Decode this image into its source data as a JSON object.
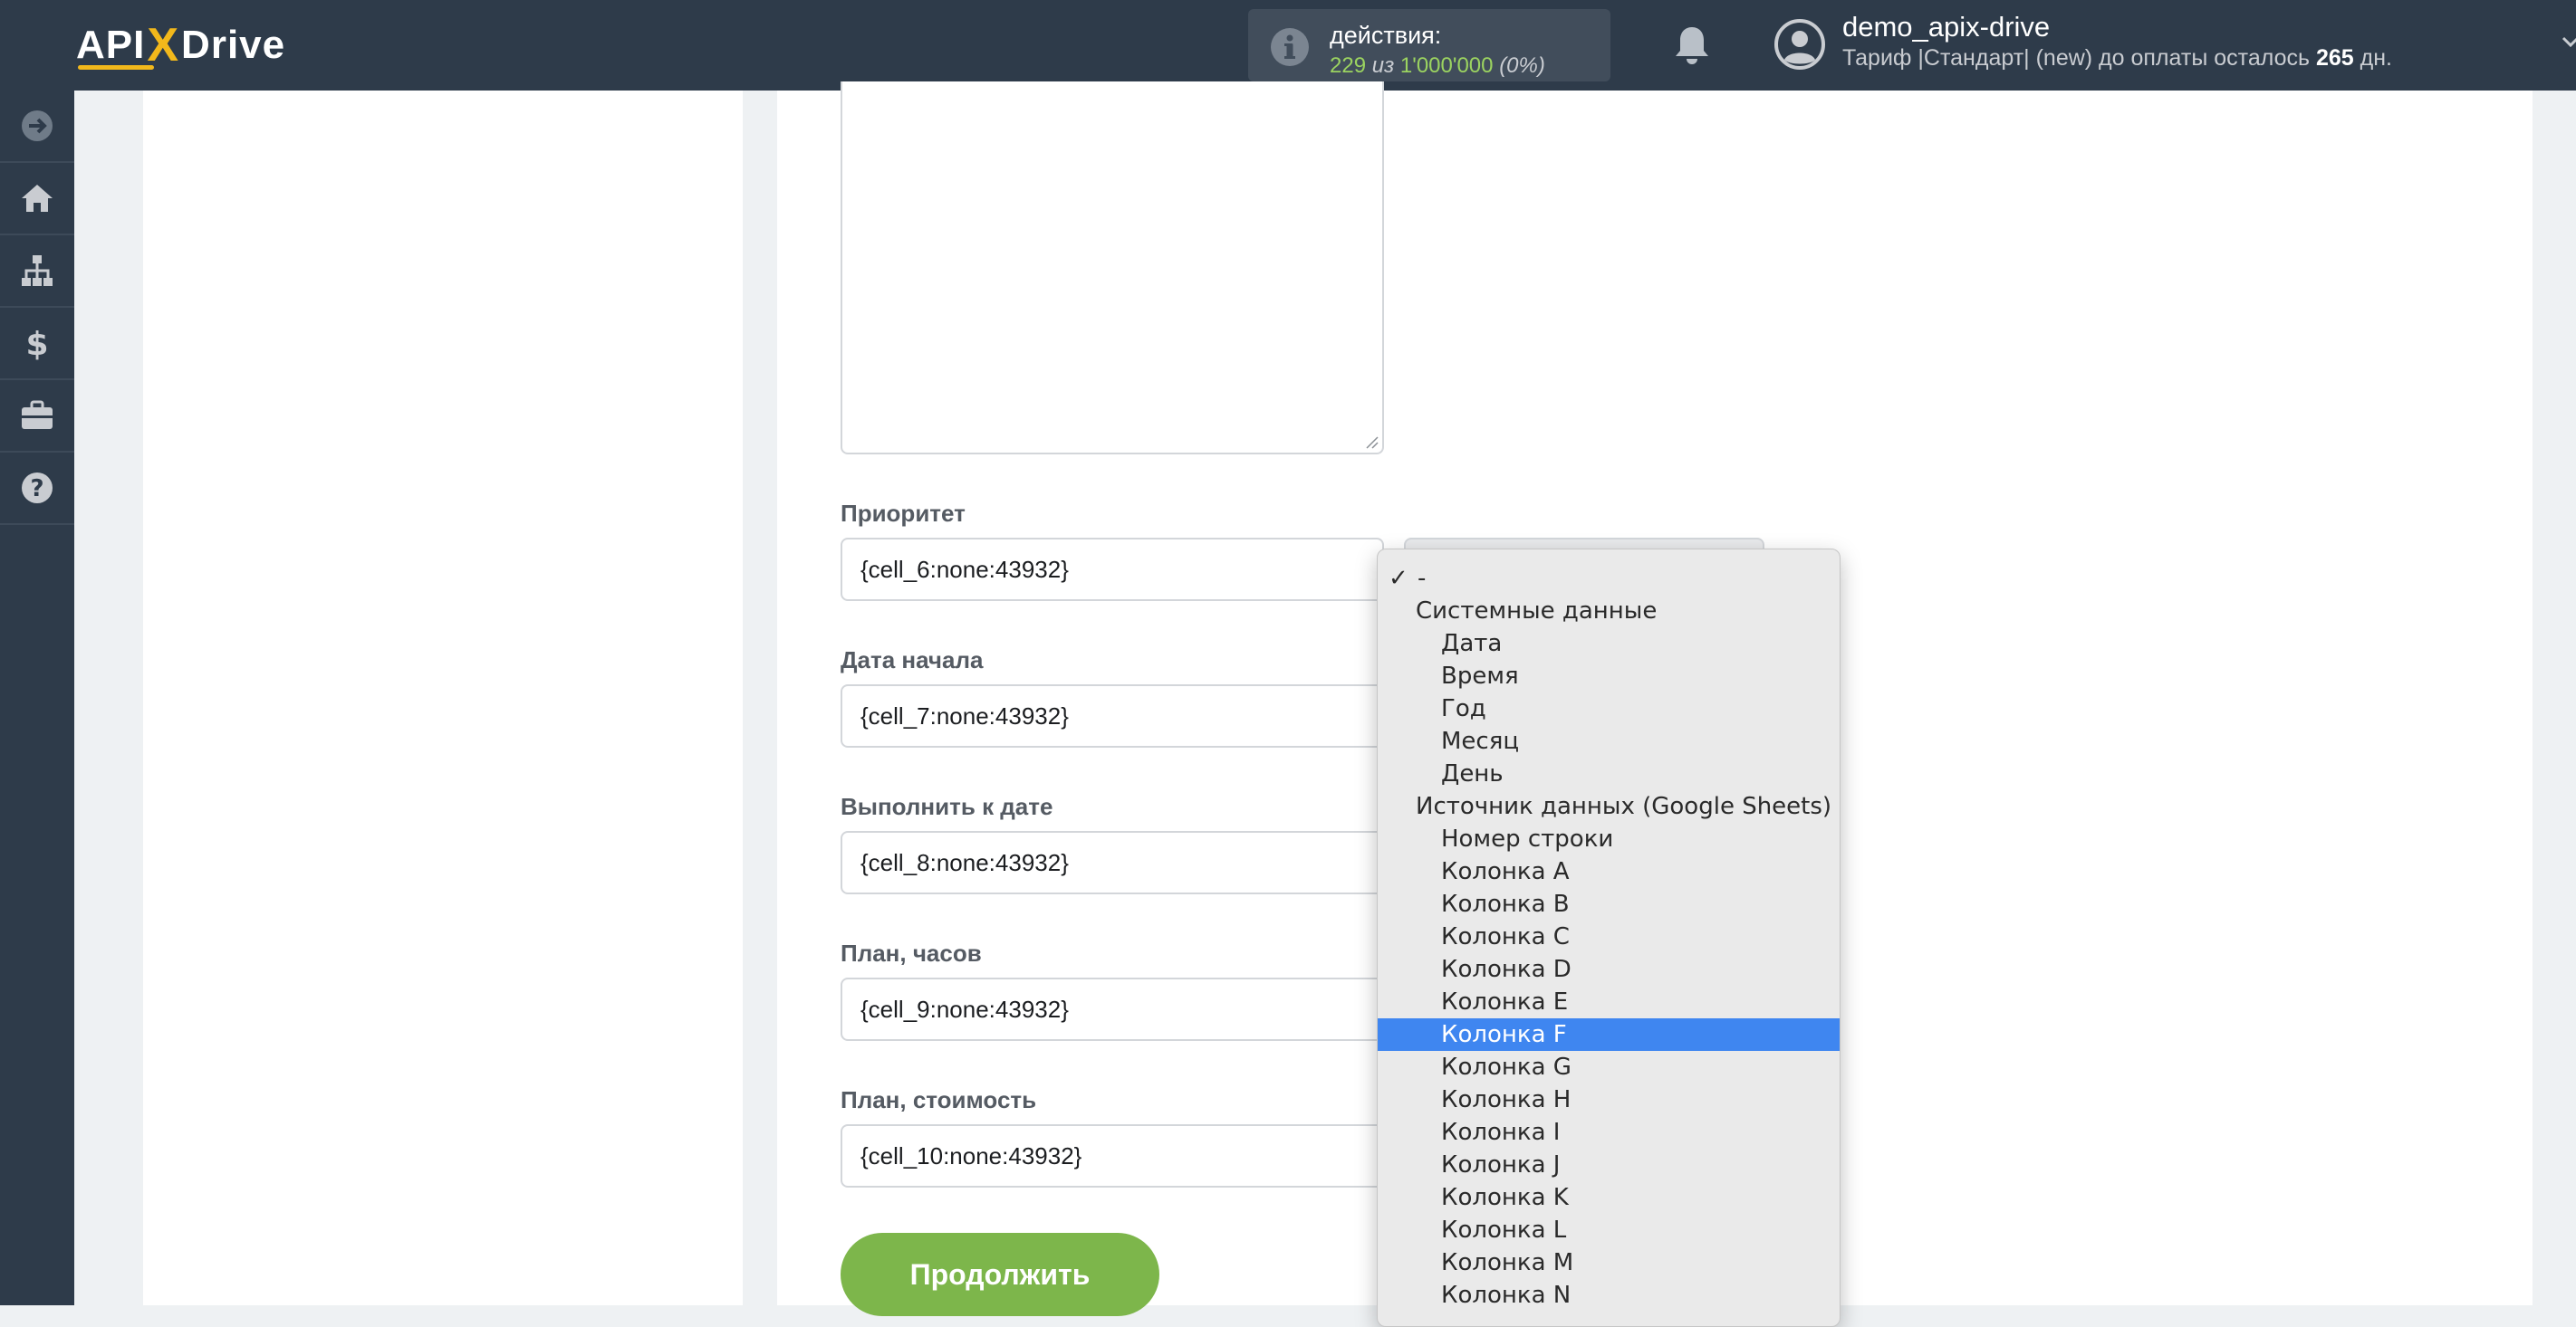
{
  "header": {
    "logo": {
      "part1": "API",
      "x": "X",
      "part2": "Drive"
    },
    "actions": {
      "title": "действия:",
      "used": "229",
      "of": "из",
      "limit": "1'000'000",
      "percent": "(0%)"
    },
    "user": {
      "name": "demo_apix-drive",
      "tariff_text": "Тариф |Стандарт| (new) до оплаты осталось",
      "days": "265",
      "days_unit": "дн."
    }
  },
  "sidebar": {
    "items": [
      "arrow-right-icon",
      "home-icon",
      "sitemap-icon",
      "dollar-icon",
      "briefcase-icon",
      "help-icon"
    ]
  },
  "form": {
    "fields": [
      {
        "label": "Приоритет",
        "value": "{cell_6:none:43932}"
      },
      {
        "label": "Дата начала",
        "value": "{cell_7:none:43932}"
      },
      {
        "label": "Выполнить к дате",
        "value": "{cell_8:none:43932}"
      },
      {
        "label": "План, часов",
        "value": "{cell_9:none:43932}"
      },
      {
        "label": "План, стоимость",
        "value": "{cell_10:none:43932}"
      }
    ],
    "continue_label": "Продолжить"
  },
  "dropdown": {
    "checkmark": "✓",
    "options": [
      {
        "label": "-",
        "indent": 0,
        "checked": true
      },
      {
        "label": "Системные данные",
        "indent": 1
      },
      {
        "label": "Дата",
        "indent": 2
      },
      {
        "label": "Время",
        "indent": 2
      },
      {
        "label": "Год",
        "indent": 2
      },
      {
        "label": "Месяц",
        "indent": 2
      },
      {
        "label": "День",
        "indent": 2
      },
      {
        "label": "Источник данных (Google Sheets)",
        "indent": 1
      },
      {
        "label": "Номер строки",
        "indent": 2
      },
      {
        "label": "Колонка A",
        "indent": 2
      },
      {
        "label": "Колонка B",
        "indent": 2
      },
      {
        "label": "Колонка C",
        "indent": 2
      },
      {
        "label": "Колонка D",
        "indent": 2
      },
      {
        "label": "Колонка E",
        "indent": 2
      },
      {
        "label": "Колонка F",
        "indent": 2,
        "highlighted": true
      },
      {
        "label": "Колонка G",
        "indent": 2
      },
      {
        "label": "Колонка H",
        "indent": 2
      },
      {
        "label": "Колонка I",
        "indent": 2
      },
      {
        "label": "Колонка J",
        "indent": 2
      },
      {
        "label": "Колонка K",
        "indent": 2
      },
      {
        "label": "Колонка L",
        "indent": 2
      },
      {
        "label": "Колонка M",
        "indent": 2
      },
      {
        "label": "Колонка N",
        "indent": 2
      }
    ]
  },
  "colors": {
    "topbar": "#2e3b4a",
    "accent_yellow": "#f2b81b",
    "button_green": "#7db64b",
    "highlight_blue": "#3f86f0",
    "count_green": "#9bd360"
  }
}
